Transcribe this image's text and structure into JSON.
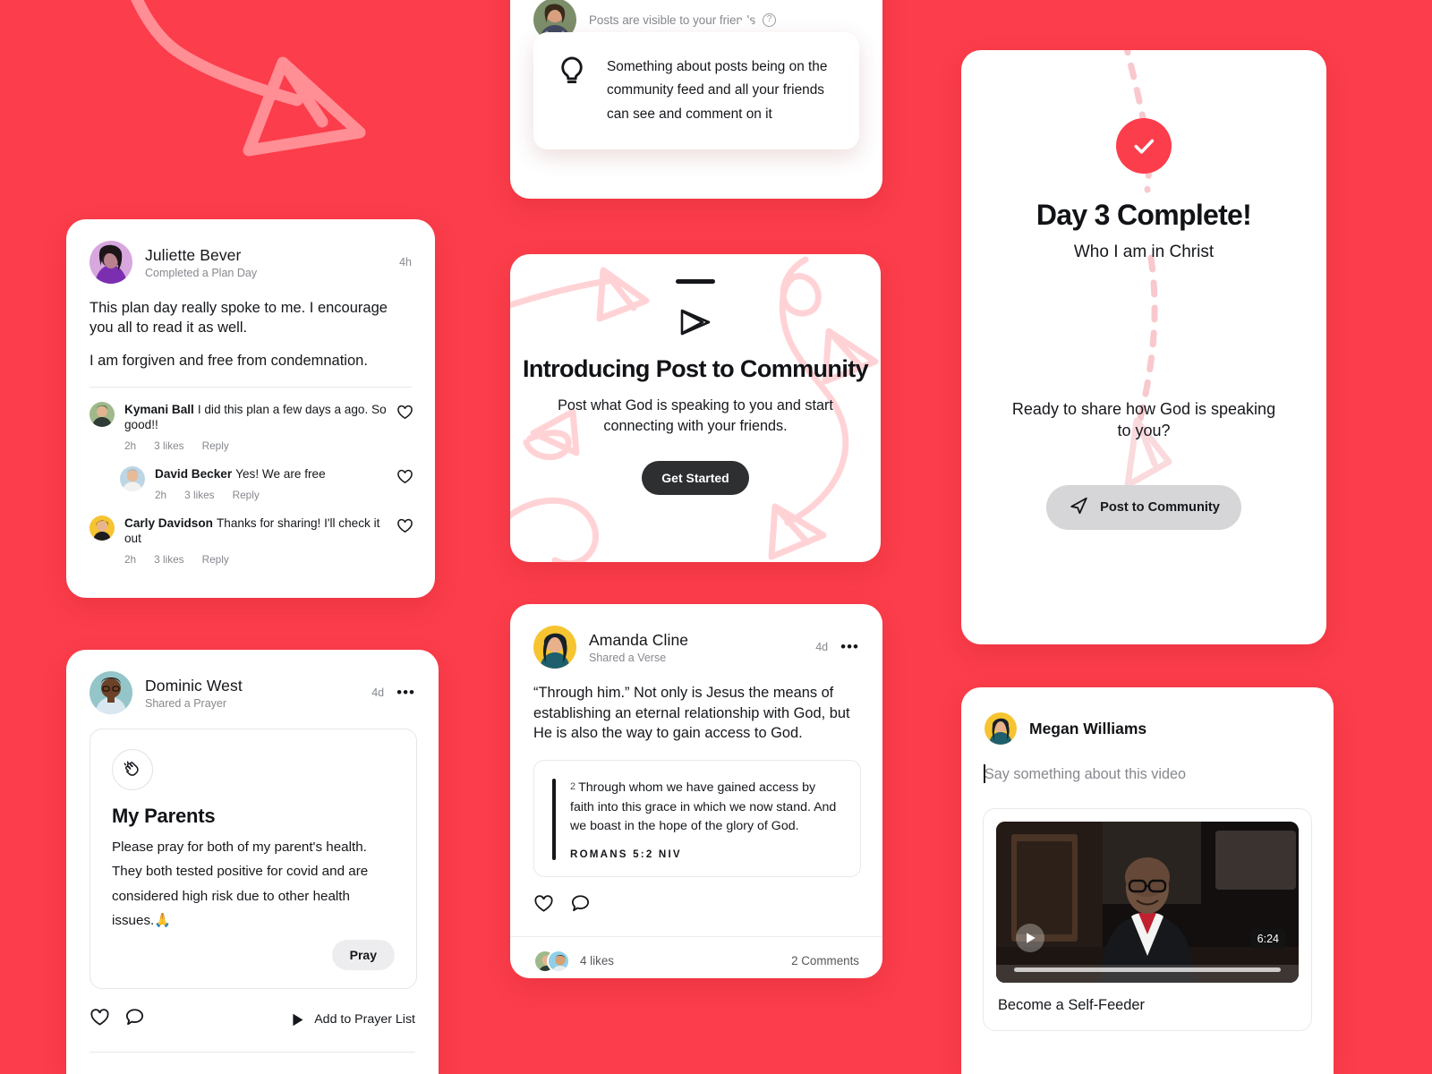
{
  "theme": {
    "background": "#fc3d4b",
    "card_background": "#ffffff",
    "accent": "#fc3d4b",
    "dark_button": "#2d2f31",
    "gray_pill": "#d6d6d8",
    "muted_text": "#86888d"
  },
  "juliette_post": {
    "author": "Juliette Bever",
    "subtitle": "Completed a Plan Day",
    "timestamp": "4h",
    "body": [
      "This plan day really spoke to me. I encourage you all to read it as well.",
      "I am forgiven and free from condemnation."
    ],
    "comments": [
      {
        "author": "Kymani Ball",
        "text": "I did this plan a few days a ago. So good!!",
        "time": "2h",
        "likes": "3 likes",
        "reply": "Reply",
        "indent": false
      },
      {
        "author": "David Becker",
        "text": "Yes! We are free",
        "time": "2h",
        "likes": "3 likes",
        "reply": "Reply",
        "indent": true
      },
      {
        "author": "Carly Davidson",
        "text": "Thanks for sharing! I'll check it out",
        "time": "2h",
        "likes": "3 likes",
        "reply": "Reply",
        "indent": false
      }
    ]
  },
  "dominic_post": {
    "author": "Dominic West",
    "subtitle": "Shared a Prayer",
    "timestamp": "4d",
    "menu": "•••",
    "prayer_icon": "clapping-hands",
    "prayer_title": "My Parents",
    "prayer_text": "Please pray for both of my parent's health. They both tested positive for covid and are considered high risk due to other health issues.🙏",
    "pray_button": "Pray",
    "add_to_prayer_list": "Add to Prayer List"
  },
  "composer": {
    "visibility_note": "Posts are visible to your friends",
    "help_icon": "question-mark-icon",
    "tooltip_icon": "lightbulb-icon",
    "tooltip_text": "Something about posts being on the community feed and all your friends can see and comment on it"
  },
  "intro_card": {
    "icon": "send-arrow-icon",
    "title": "Introducing Post to Community",
    "subtitle": "Post what God is speaking to you and start connecting with your friends.",
    "button": "Get Started"
  },
  "amanda_post": {
    "author": "Amanda Cline",
    "subtitle": "Shared a Verse",
    "timestamp": "4d",
    "menu": "•••",
    "body": "“Through him.” Not only is Jesus the means of establishing an eternal relationship with God, but He is also the way to gain access to God.",
    "verse_number": "2",
    "verse_text": "Through whom we have gained access by faith into this grace in which we now stand. And we boast in the hope of the glory of God.",
    "verse_reference": "ROMANS 5:2 NIV",
    "likes": "4 likes",
    "comments": "2 Comments"
  },
  "day3_card": {
    "check_icon": "checkmark-icon",
    "title": "Day 3 Complete!",
    "subtitle": "Who I am in Christ",
    "question": "Ready to share how God is speaking to you?",
    "button": "Post to Community",
    "button_icon": "send-arrow-icon"
  },
  "megan_post": {
    "author": "Megan Williams",
    "placeholder": "Say something about this video",
    "video_duration": "6:24",
    "video_title": "Become a Self-Feeder",
    "play_icon": "play-icon"
  }
}
